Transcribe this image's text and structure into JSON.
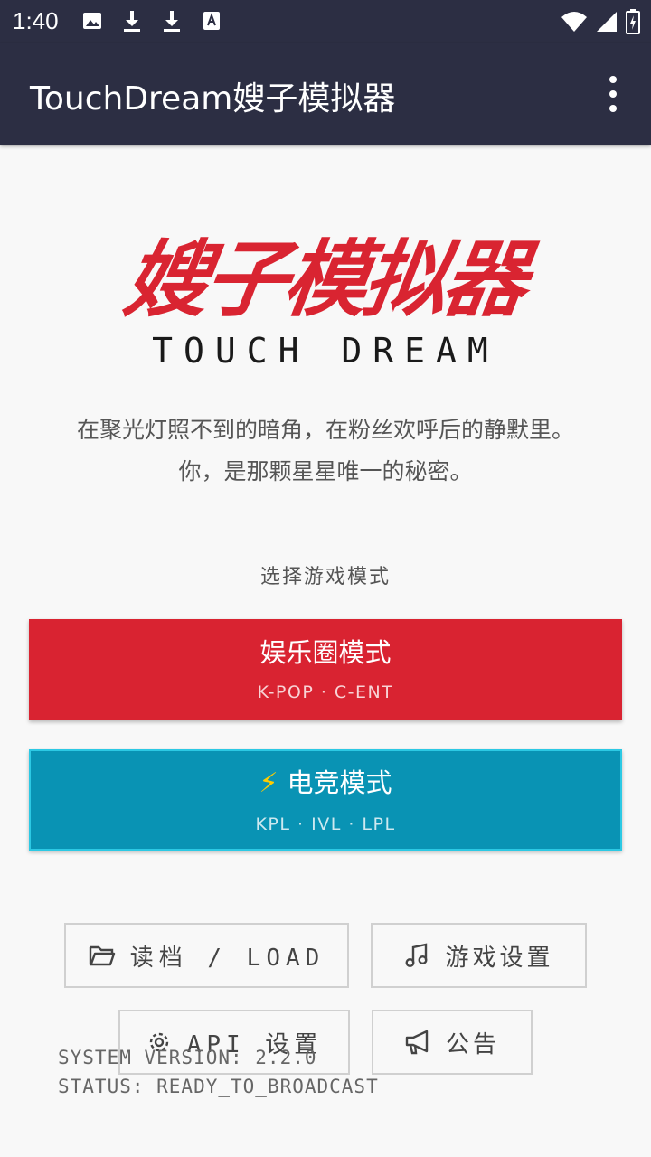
{
  "status_bar": {
    "time": "1:40",
    "left_icons": [
      "image-icon",
      "download-icon",
      "download-icon",
      "font-a-icon"
    ],
    "right_icons": [
      "wifi-icon",
      "signal-icon",
      "battery-charging-icon"
    ]
  },
  "app_bar": {
    "title": "TouchDream嫂子模拟器",
    "menu_icon": "more-vert-icon"
  },
  "hero": {
    "logo_text": "嫂子模拟器",
    "logo_sub": "TOUCH DREAM",
    "tagline_line1": "在聚光灯照不到的暗角，在粉丝欢呼后的静默里。",
    "tagline_line2": "你，是那颗星星唯一的秘密。"
  },
  "mode_select": {
    "label": "选择游戏模式",
    "modes": [
      {
        "title": "娱乐圈模式",
        "subtitle": "K-POP · C-ENT",
        "color": "#d92331"
      },
      {
        "title": "电竞模式",
        "subtitle": "KPL · IVL · LPL",
        "icon": "⚡",
        "color": "#0993b4"
      }
    ]
  },
  "actions": {
    "load": "读档 / LOAD",
    "settings": "游戏设置",
    "api": "API 设置",
    "notice": "公告"
  },
  "system": {
    "version": "SYSTEM VERSION: 2.2.0",
    "status": "STATUS: READY_TO_BROADCAST"
  },
  "colors": {
    "app_bar": "#2c2e43",
    "accent_red": "#d92331",
    "accent_cyan": "#0993b4"
  }
}
